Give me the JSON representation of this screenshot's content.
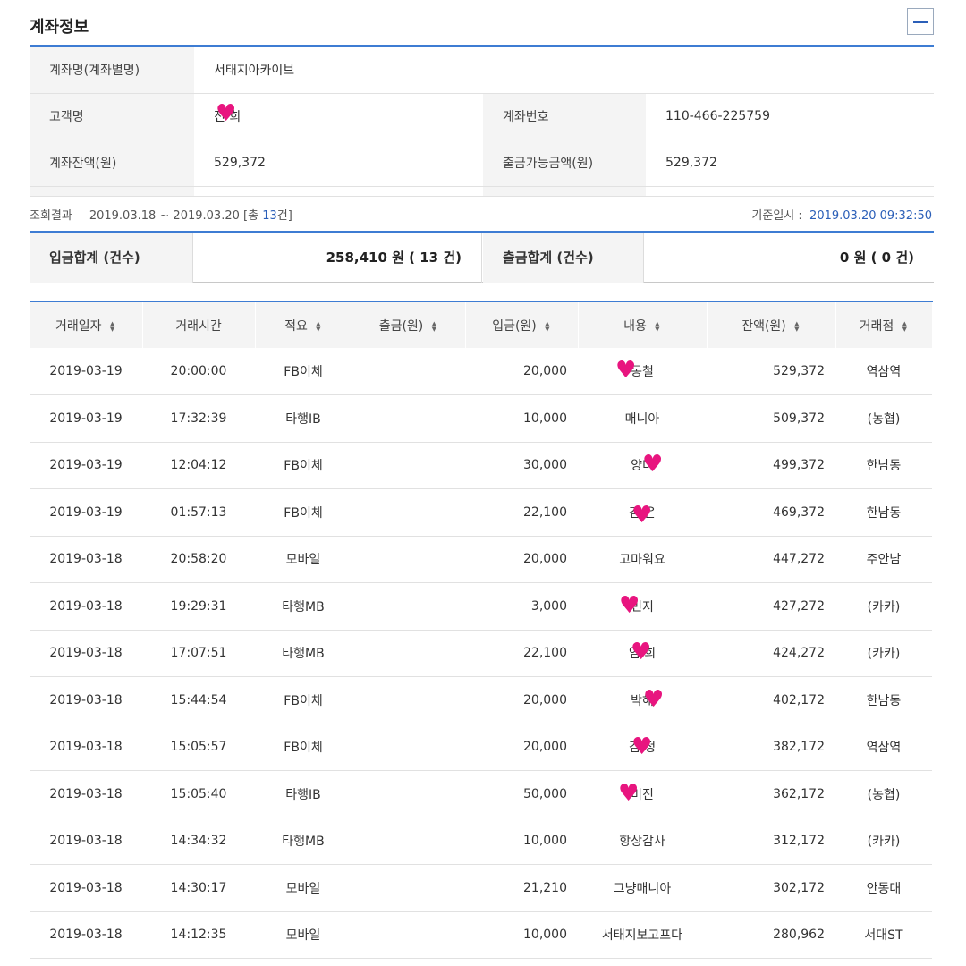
{
  "section": {
    "title": "계좌정보",
    "collapse_icon": "minus-icon"
  },
  "account": {
    "name_label": "계좌명(계좌별명)",
    "name_value": "서태지아카이브",
    "customer_label": "고객명",
    "customer_value": "진  희",
    "account_no_label": "계좌번호",
    "account_no_value": "110-466-225759",
    "balance_label": "계좌잔액(원)",
    "balance_value": "529,372",
    "withdrawable_label": "출금가능금액(원)",
    "withdrawable_value": "529,372"
  },
  "result": {
    "label": "조회결과",
    "period": "2019.03.18 ~ 2019.03.20",
    "count_prefix": "[총 ",
    "count": "13",
    "count_suffix": "건]",
    "base_label": "기준일시 :",
    "base_value": "2019.03.20 09:32:50"
  },
  "summary": {
    "deposit_label": "입금합계 (건수)",
    "deposit_value": "258,410 원 ( 13 건)",
    "withdraw_label": "출금합계 (건수)",
    "withdraw_value": "0 원 ( 0 건)"
  },
  "table": {
    "headers": [
      {
        "label": "거래일자",
        "sortable": true
      },
      {
        "label": "거래시간",
        "sortable": false
      },
      {
        "label": "적요",
        "sortable": true
      },
      {
        "label": "출금(원)",
        "sortable": true
      },
      {
        "label": "입금(원)",
        "sortable": true
      },
      {
        "label": "내용",
        "sortable": true
      },
      {
        "label": "잔액(원)",
        "sortable": true
      },
      {
        "label": "거래점",
        "sortable": true
      }
    ],
    "rows": [
      [
        "2019-03-19",
        "20:00:00",
        "FB이체",
        "",
        "20,000",
        "동철",
        "529,372",
        "역삼역"
      ],
      [
        "2019-03-19",
        "17:32:39",
        "타행IB",
        "",
        "10,000",
        "매니아",
        "509,372",
        "(농협)"
      ],
      [
        "2019-03-19",
        "12:04:12",
        "FB이체",
        "",
        "30,000",
        "양미",
        "499,372",
        "한남동"
      ],
      [
        "2019-03-19",
        "01:57:13",
        "FB이체",
        "",
        "22,100",
        "김  은",
        "469,372",
        "한남동"
      ],
      [
        "2019-03-18",
        "20:58:20",
        "모바일",
        "",
        "20,000",
        "고마워요",
        "447,272",
        "주안남"
      ],
      [
        "2019-03-18",
        "19:29:31",
        "타행MB",
        "",
        "3,000",
        "민지",
        "427,272",
        "(카카)"
      ],
      [
        "2019-03-18",
        "17:07:51",
        "타행MB",
        "",
        "22,100",
        "임  희",
        "424,272",
        "(카카)"
      ],
      [
        "2019-03-18",
        "15:44:54",
        "FB이체",
        "",
        "20,000",
        "박해",
        "402,172",
        "한남동"
      ],
      [
        "2019-03-18",
        "15:05:57",
        "FB이체",
        "",
        "20,000",
        "김  정",
        "382,172",
        "역삼역"
      ],
      [
        "2019-03-18",
        "15:05:40",
        "타행IB",
        "",
        "50,000",
        "미진",
        "362,172",
        "(농협)"
      ],
      [
        "2019-03-18",
        "14:34:32",
        "타행MB",
        "",
        "10,000",
        "항상감사",
        "312,172",
        "(카카)"
      ],
      [
        "2019-03-18",
        "14:30:17",
        "모바일",
        "",
        "21,210",
        "그냥매니아",
        "302,172",
        "안동대"
      ],
      [
        "2019-03-18",
        "14:12:35",
        "모바일",
        "",
        "10,000",
        "서태지보고프다",
        "280,962",
        "서대ST"
      ]
    ]
  },
  "decorations": {
    "heart_icon": "♥",
    "heart_color": "#e8157f"
  }
}
